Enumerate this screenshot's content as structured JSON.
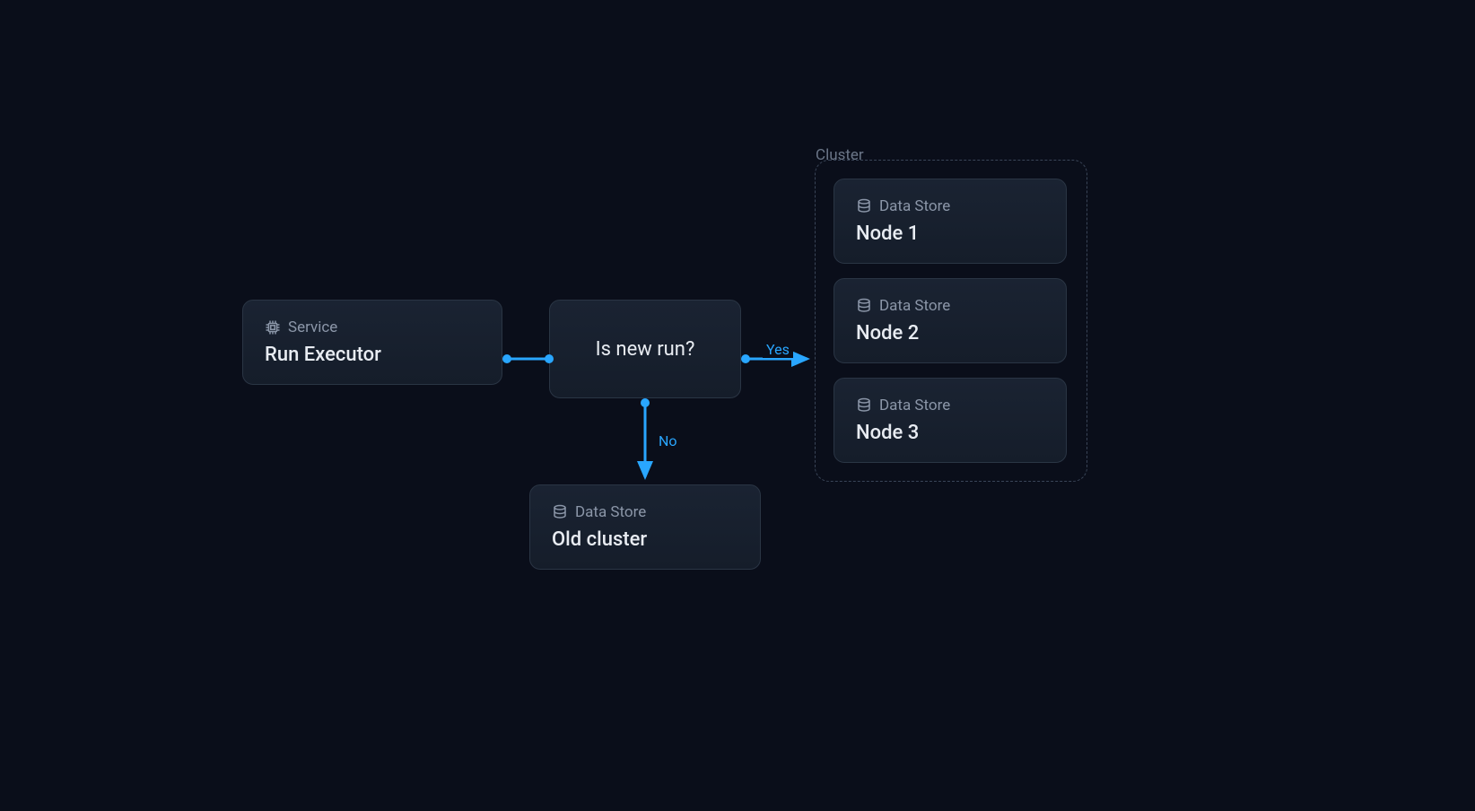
{
  "nodes": {
    "executor": {
      "type_label": "Service",
      "title": "Run Executor"
    },
    "decision": {
      "text": "Is new run?"
    },
    "old_cluster": {
      "type_label": "Data Store",
      "title": "Old cluster"
    }
  },
  "cluster": {
    "label": "Cluster",
    "nodes": [
      {
        "type_label": "Data Store",
        "title": "Node 1"
      },
      {
        "type_label": "Data Store",
        "title": "Node 2"
      },
      {
        "type_label": "Data Store",
        "title": "Node 3"
      }
    ]
  },
  "edges": {
    "yes_label": "Yes",
    "no_label": "No"
  },
  "colors": {
    "accent": "#29a6ff",
    "background": "#0a0e1a",
    "node_bg": "#1a2332",
    "border": "#2a3544",
    "text_primary": "#e8ecf2",
    "text_secondary": "#8b96a8"
  }
}
